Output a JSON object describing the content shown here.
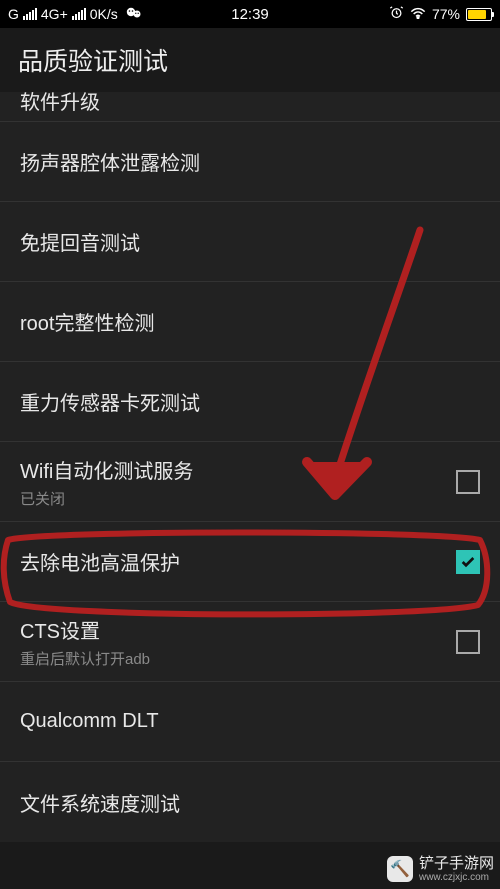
{
  "status": {
    "carrier": "G",
    "net1": "4G+",
    "speed": "0K/s",
    "time": "12:39",
    "battery_pct": "77%"
  },
  "header": {
    "title": "品质验证测试"
  },
  "items": [
    {
      "title": "软件升级",
      "sub": "",
      "checkbox": null
    },
    {
      "title": "扬声器腔体泄露检测",
      "sub": "",
      "checkbox": null
    },
    {
      "title": "免提回音测试",
      "sub": "",
      "checkbox": null
    },
    {
      "title": "root完整性检测",
      "sub": "",
      "checkbox": null
    },
    {
      "title": "重力传感器卡死测试",
      "sub": "",
      "checkbox": null
    },
    {
      "title": "Wifi自动化测试服务",
      "sub": "已关闭",
      "checkbox": false
    },
    {
      "title": "去除电池高温保护",
      "sub": "",
      "checkbox": true
    },
    {
      "title": "CTS设置",
      "sub": "重启后默认打开adb",
      "checkbox": false
    },
    {
      "title": "Qualcomm DLT",
      "sub": "",
      "checkbox": null
    },
    {
      "title": "文件系统速度测试",
      "sub": "",
      "checkbox": null
    }
  ],
  "annotation": {
    "highlight_index": 6,
    "arrow_color": "#b02020",
    "arrow_label": ""
  },
  "watermark": {
    "cn": "铲子手游网",
    "url": "www.czjxjc.com"
  }
}
